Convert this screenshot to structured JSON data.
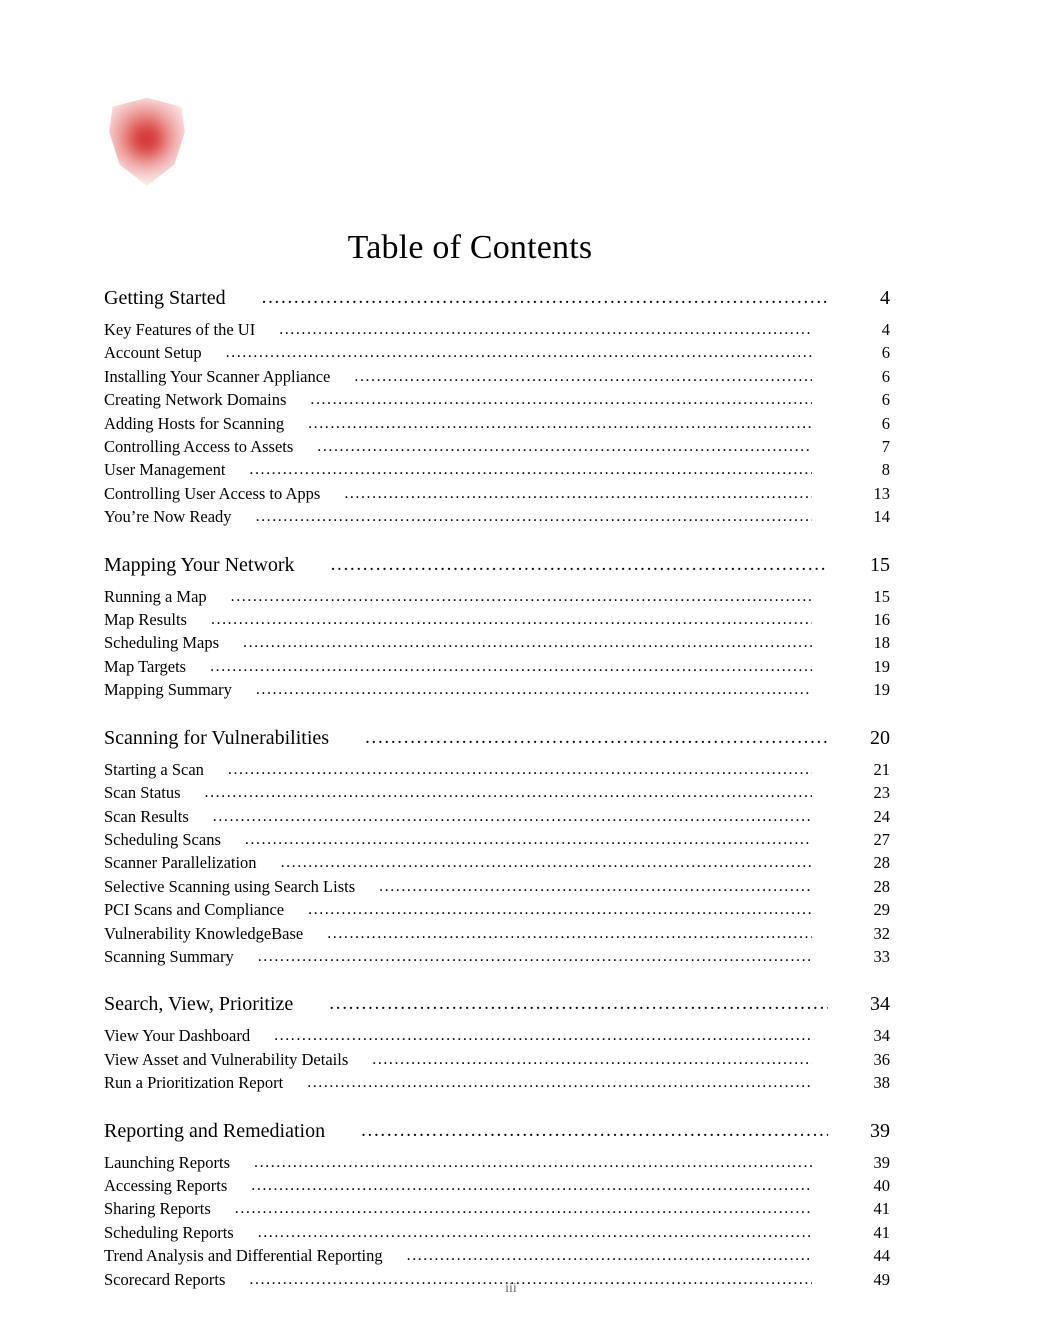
{
  "document": {
    "title": "Table of Contents",
    "logo_icon": "shield-logo",
    "footer_page_label": "iii",
    "accent_color": "#cd2828"
  },
  "toc": {
    "groups": [
      {
        "heading": {
          "label": "Getting Started",
          "page": "4"
        },
        "entries": [
          {
            "label": "Key Features of the UI",
            "page": "4"
          },
          {
            "label": "Account Setup",
            "page": "6"
          },
          {
            "label": "Installing Your Scanner Appliance",
            "page": "6"
          },
          {
            "label": "Creating Network Domains",
            "page": "6"
          },
          {
            "label": "Adding Hosts for Scanning",
            "page": "6"
          },
          {
            "label": "Controlling Access to Assets",
            "page": "7"
          },
          {
            "label": "User Management",
            "page": "8"
          },
          {
            "label": "Controlling User Access to Apps",
            "page": "13"
          },
          {
            "label": "You’re Now Ready",
            "page": "14"
          }
        ]
      },
      {
        "heading": {
          "label": "Mapping Your Network",
          "page": "15"
        },
        "entries": [
          {
            "label": "Running a Map",
            "page": "15"
          },
          {
            "label": "Map Results",
            "page": "16"
          },
          {
            "label": "Scheduling Maps",
            "page": "18"
          },
          {
            "label": "Map Targets",
            "page": "19"
          },
          {
            "label": "Mapping Summary",
            "page": "19"
          }
        ]
      },
      {
        "heading": {
          "label": "Scanning for Vulnerabilities",
          "page": "20"
        },
        "entries": [
          {
            "label": "Starting a Scan",
            "page": "21"
          },
          {
            "label": "Scan Status",
            "page": "23"
          },
          {
            "label": "Scan Results",
            "page": "24"
          },
          {
            "label": "Scheduling Scans",
            "page": "27"
          },
          {
            "label": "Scanner Parallelization",
            "page": "28"
          },
          {
            "label": "Selective Scanning using Search Lists",
            "page": "28"
          },
          {
            "label": "PCI Scans and Compliance",
            "page": "29"
          },
          {
            "label": "Vulnerability KnowledgeBase",
            "page": "32"
          },
          {
            "label": "Scanning Summary",
            "page": "33"
          }
        ]
      },
      {
        "heading": {
          "label": "Search, View, Prioritize",
          "page": "34"
        },
        "entries": [
          {
            "label": "View Your Dashboard",
            "page": "34"
          },
          {
            "label": "View Asset and Vulnerability Details",
            "page": "36"
          },
          {
            "label": "Run a Prioritization Report",
            "page": "38"
          }
        ]
      },
      {
        "heading": {
          "label": "Reporting and Remediation",
          "page": "39"
        },
        "entries": [
          {
            "label": "Launching Reports",
            "page": "39"
          },
          {
            "label": "Accessing Reports",
            "page": "40"
          },
          {
            "label": "Sharing Reports",
            "page": "41"
          },
          {
            "label": "Scheduling Reports",
            "page": "41"
          },
          {
            "label": "Trend Analysis and Differential Reporting",
            "page": "44"
          },
          {
            "label": "Scorecard Reports",
            "page": "49"
          }
        ]
      }
    ]
  }
}
